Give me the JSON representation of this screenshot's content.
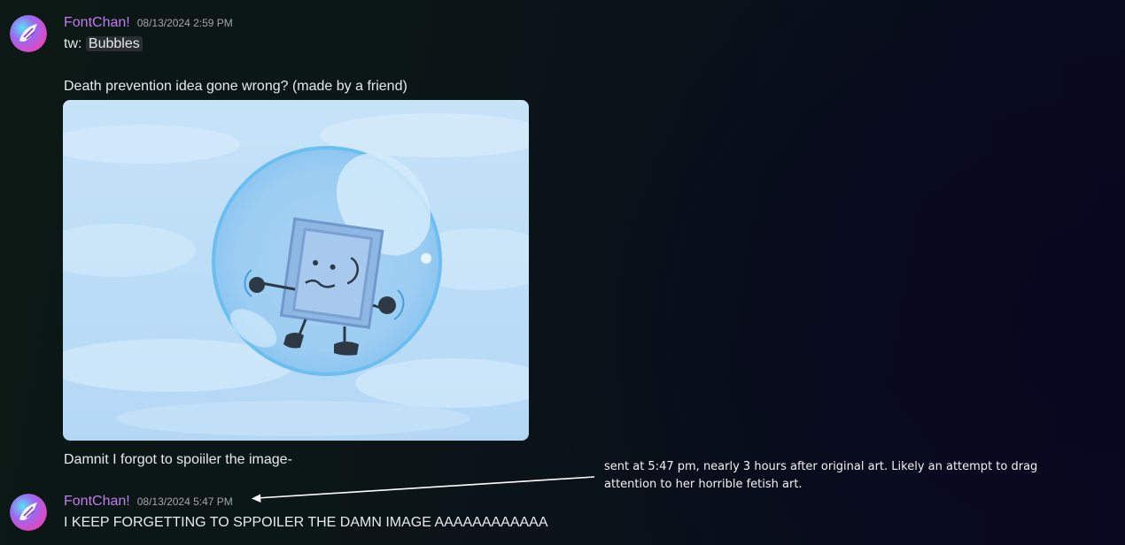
{
  "messages": [
    {
      "username": "FontChan!",
      "timestamp": "08/13/2024 2:59 PM",
      "spoiler_prefix": "tw: ",
      "spoiler_text": "Bubbles",
      "caption": "Death prevention idea gone wrong? (made by a friend)",
      "followup": "Damnit I forgot to spoiiler the image-"
    },
    {
      "username": "FontChan!",
      "timestamp": "08/13/2024 5:47 PM",
      "text": "I KEEP FORGETTING TO SPPOILER THE DAMN IMAGE AAAAAAAAAAAA"
    }
  ],
  "annotation": {
    "text": "sent at 5:47 pm, nearly 3 hours after original art. Likely an attempt to drag attention to her horrible fetish art."
  },
  "colors": {
    "username": "#c27bf0",
    "timestamp": "#a2a6ad",
    "message_text": "#e7e9ec",
    "spoiler_bg": "#2a2d31"
  },
  "icons": {
    "avatar": "avatar-icon",
    "annotation_arrow": "arrow-icon"
  }
}
